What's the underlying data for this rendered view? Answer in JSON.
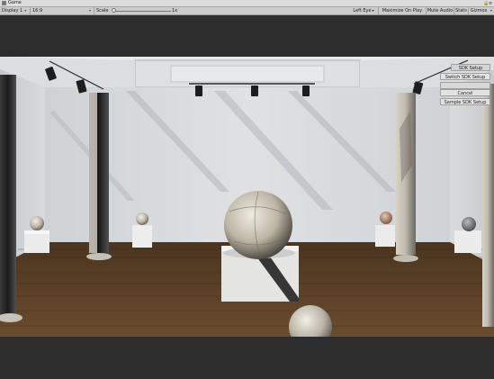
{
  "window": {
    "tab_label": "Game"
  },
  "toolbar": {
    "display": "Display 1",
    "aspect": "16:9",
    "scale_label": "Scale",
    "scale_value": "1x",
    "left_eye": "Left Eye",
    "maximize_on_play": "Maximize On Play",
    "mute_audio": "Mute Audio",
    "stats": "Stats",
    "gizmos": "Gizmos"
  },
  "sdk_menu": {
    "buttons": [
      {
        "label": "SDK Setup"
      },
      {
        "label": "Switch SDK Setup"
      },
      {
        "label": "Cancel"
      },
      {
        "label": "Sample SDK Setup"
      }
    ]
  },
  "icons": [
    "window-tab-icon",
    "lock-icon",
    "window-menu-icon",
    "spotlight-icon",
    "marble-sphere-icon"
  ],
  "colors": {
    "toolbar": "#cbcbcb",
    "titlebar": "#dcdcdc",
    "letterbox": "#2d2d2d",
    "floor": "#5a4026"
  }
}
